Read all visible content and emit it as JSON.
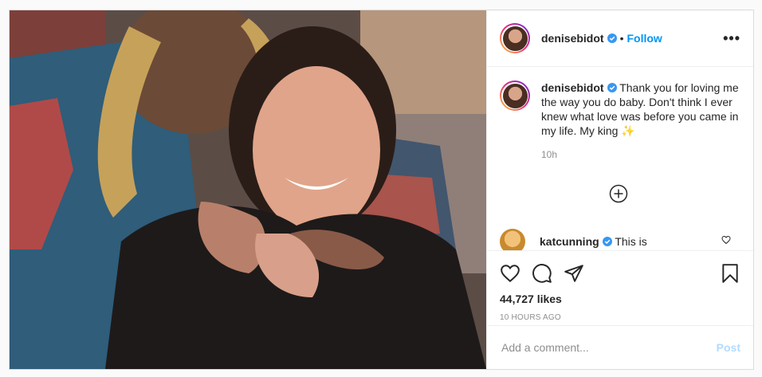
{
  "header": {
    "username": "denisebidot",
    "separator": "•",
    "follow_label": "Follow",
    "more_label": "•••"
  },
  "caption": {
    "username": "denisebidot",
    "text": "Thank you for loving me the way you do baby. Don't think I ever knew what love was before you came in my life. My king ✨",
    "time": "10h"
  },
  "comment": {
    "username": "katcunning",
    "text": "This is"
  },
  "stats": {
    "likes": "44,727 likes",
    "posted": "10 HOURS AGO"
  },
  "add_comment": {
    "placeholder": "Add a comment...",
    "post_label": "Post"
  },
  "icons": [
    "verified-badge-icon",
    "heart-icon",
    "comment-icon",
    "share-icon",
    "bookmark-icon",
    "plus-circle-icon",
    "more-icon"
  ],
  "colors": {
    "accent": "#0095f6",
    "post_disabled": "#b3dbff",
    "muted": "#8e8e8e"
  }
}
